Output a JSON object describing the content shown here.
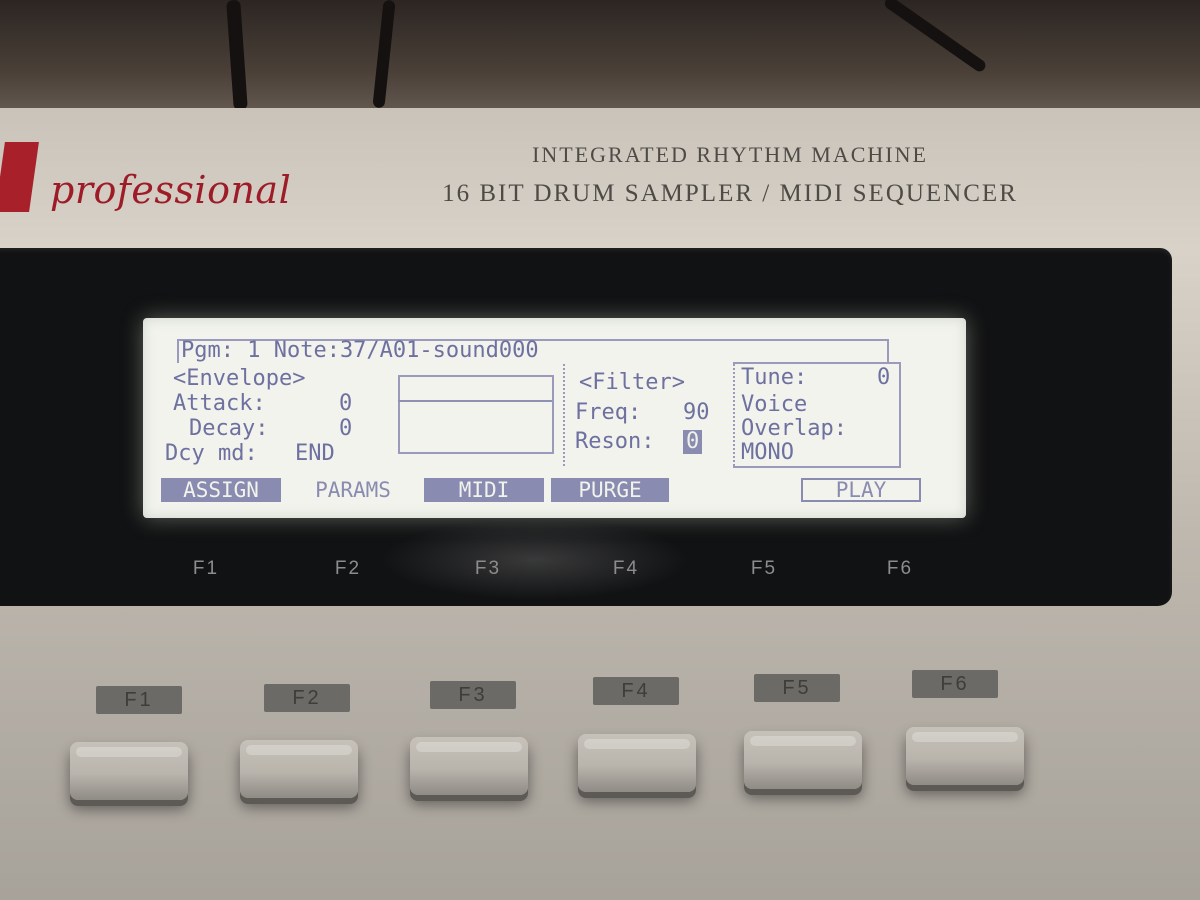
{
  "header": {
    "brand": "professional",
    "line1": "INTEGRATED RHYTHM MACHINE",
    "line2": "16 BIT DRUM SAMPLER / MIDI SEQUENCER"
  },
  "lcd": {
    "status": "Pgm: 1 Note:37/A01-sound000",
    "envelope": {
      "title": "<Envelope>",
      "attack_label": "Attack:",
      "attack_value": "0",
      "decay_label": "Decay:",
      "decay_value": "0",
      "decay_mode_label": "Dcy md:",
      "decay_mode_value": "END"
    },
    "filter": {
      "title": "<Filter>",
      "freq_label": "Freq:",
      "freq_value": "90",
      "reson_label": "Reson:",
      "reson_value": "0"
    },
    "tune": {
      "label": "Tune:",
      "value": "0"
    },
    "voice": {
      "label1": "Voice",
      "label2": "Overlap:",
      "value": "MONO"
    },
    "softkeys": {
      "assign": "ASSIGN",
      "params": "PARAMS",
      "midi": "MIDI",
      "purge": "PURGE",
      "play": "PLAY"
    }
  },
  "bezel_keys": [
    "F1",
    "F2",
    "F3",
    "F4",
    "F5",
    "F6"
  ],
  "button_tags": [
    "F1",
    "F2",
    "F3",
    "F4",
    "F5",
    "F6"
  ],
  "colors": {
    "lcd_background": "#f1f3ec",
    "lcd_text": "#6e70a0",
    "brand_red": "#9e1c28",
    "chassis": "#c9c3ba"
  }
}
